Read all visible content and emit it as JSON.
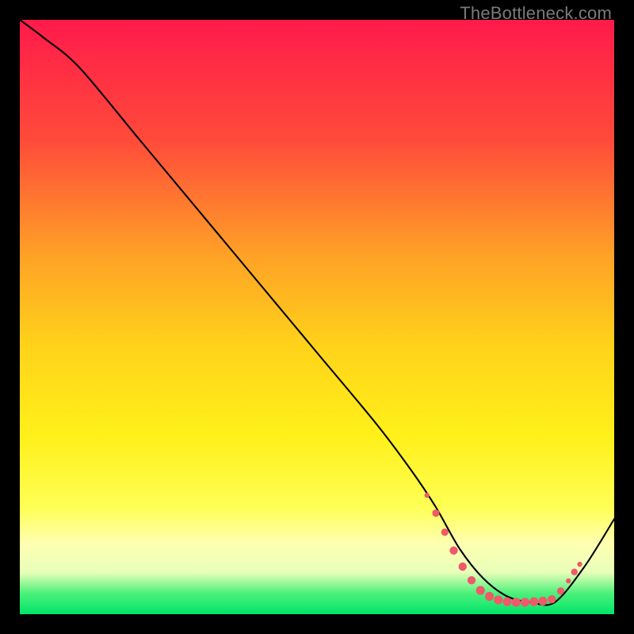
{
  "attribution": "TheBottleneck.com",
  "chart_data": {
    "type": "line",
    "title": "",
    "xlabel": "",
    "ylabel": "",
    "xlim": [
      0,
      100
    ],
    "ylim": [
      0,
      100
    ],
    "gradient_stops": [
      {
        "offset": 0.0,
        "color": "#ff1a4b"
      },
      {
        "offset": 0.2,
        "color": "#ff4a3a"
      },
      {
        "offset": 0.4,
        "color": "#ffa326"
      },
      {
        "offset": 0.55,
        "color": "#ffd31a"
      },
      {
        "offset": 0.7,
        "color": "#fff01a"
      },
      {
        "offset": 0.82,
        "color": "#ffff55"
      },
      {
        "offset": 0.88,
        "color": "#ffffb0"
      },
      {
        "offset": 0.93,
        "color": "#e7ffb8"
      },
      {
        "offset": 0.965,
        "color": "#4cf07a"
      },
      {
        "offset": 1.0,
        "color": "#00e56a"
      }
    ],
    "series": [
      {
        "name": "bottleneck-curve",
        "x": [
          0,
          4,
          10,
          20,
          30,
          40,
          50,
          60,
          66,
          70,
          74,
          78,
          82,
          86,
          90,
          95,
          100
        ],
        "y": [
          100,
          97,
          92,
          80,
          68,
          56,
          44,
          32,
          24,
          18,
          11,
          6,
          3,
          2,
          2,
          8,
          16
        ]
      }
    ],
    "markers": {
      "name": "dotted-valley",
      "color": "#ef5a6a",
      "points": [
        {
          "x": 68.5,
          "y": 20.0,
          "r": 3.2
        },
        {
          "x": 70.0,
          "y": 17.0,
          "r": 4.6
        },
        {
          "x": 71.5,
          "y": 13.8,
          "r": 4.6
        },
        {
          "x": 73.0,
          "y": 10.7,
          "r": 5.2
        },
        {
          "x": 74.5,
          "y": 8.0,
          "r": 5.2
        },
        {
          "x": 76.0,
          "y": 5.7,
          "r": 5.2
        },
        {
          "x": 77.5,
          "y": 4.0,
          "r": 5.6
        },
        {
          "x": 79.0,
          "y": 3.0,
          "r": 5.6
        },
        {
          "x": 80.5,
          "y": 2.4,
          "r": 5.6
        },
        {
          "x": 82.0,
          "y": 2.1,
          "r": 5.6
        },
        {
          "x": 83.5,
          "y": 2.0,
          "r": 5.6
        },
        {
          "x": 85.0,
          "y": 2.0,
          "r": 5.6
        },
        {
          "x": 86.5,
          "y": 2.1,
          "r": 5.6
        },
        {
          "x": 88.0,
          "y": 2.2,
          "r": 5.6
        },
        {
          "x": 89.5,
          "y": 2.5,
          "r": 5.2
        },
        {
          "x": 91.0,
          "y": 3.9,
          "r": 4.6
        },
        {
          "x": 92.3,
          "y": 5.6,
          "r": 3.2
        },
        {
          "x": 93.3,
          "y": 7.1,
          "r": 4.2
        },
        {
          "x": 94.2,
          "y": 8.4,
          "r": 3.2
        }
      ]
    }
  }
}
